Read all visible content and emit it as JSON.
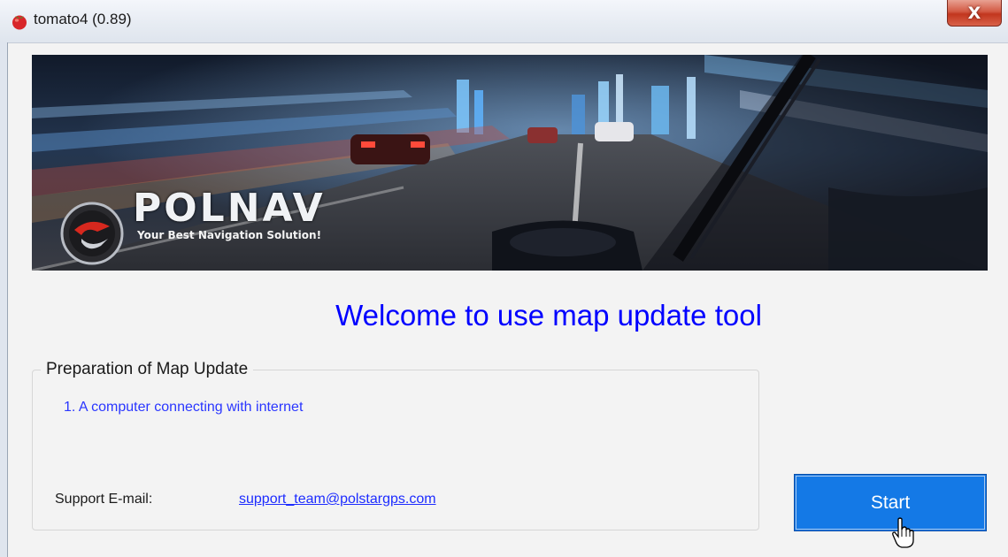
{
  "window": {
    "title": "tomato4 (0.89)",
    "close_symbol": "X"
  },
  "banner": {
    "brand": "POLNAV",
    "tagline": "Your Best Navigation Solution!"
  },
  "main": {
    "welcome": "Welcome to use map update tool"
  },
  "preparation": {
    "title": "Preparation of Map Update",
    "items": [
      "1. A computer connecting with internet"
    ],
    "support_label": "Support E-mail:",
    "support_email": "support_team@polstargps.com"
  },
  "actions": {
    "start_label": "Start"
  },
  "icons": {
    "app": "tomato-icon",
    "close": "close-icon",
    "cursor": "hand-pointer-icon",
    "logo": "polnav-logo-icon"
  },
  "colors": {
    "welcome_text": "#0000ff",
    "link": "#1d2cff",
    "start_button": "#1479e6",
    "close_button": "#c2361e"
  }
}
